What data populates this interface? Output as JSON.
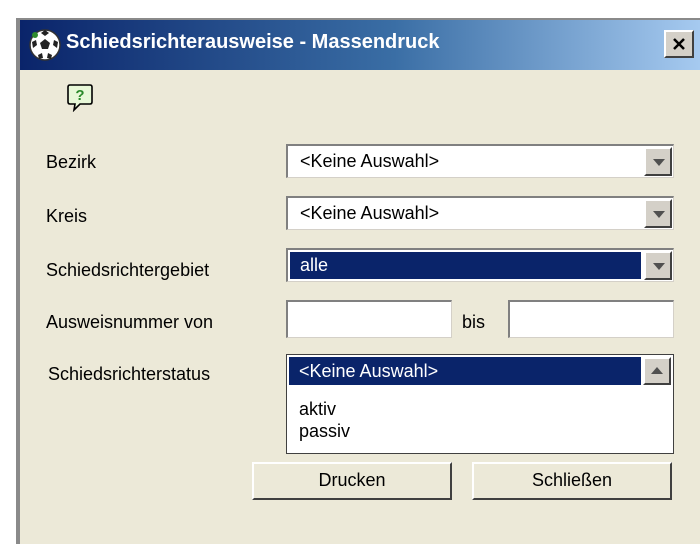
{
  "window": {
    "title": "Schiedsrichterausweise - Massendruck",
    "close_glyph": "×"
  },
  "toolbar": {
    "help_icon": "help-question-icon"
  },
  "form": {
    "bezirk": {
      "label": "Bezirk",
      "value": "<Keine Auswahl>"
    },
    "kreis": {
      "label": "Kreis",
      "value": "<Keine Auswahl>"
    },
    "gebiet": {
      "label": "Schiedsrichtergebiet",
      "value": "alle"
    },
    "ausweis": {
      "label_from": "Ausweisnummer von",
      "label_to": "bis",
      "value_from": "",
      "value_to": ""
    },
    "status": {
      "label": "Schiedsrichterstatus",
      "options": [
        "<Keine Auswahl>",
        "aktiv",
        "passiv"
      ],
      "selected": "<Keine Auswahl>"
    }
  },
  "buttons": {
    "print": "Drucken",
    "close": "Schließen"
  },
  "colors": {
    "selection": "#0a246a",
    "dialog_bg": "#ece9d8",
    "title_start": "#0a246a",
    "title_end": "#a6caf0"
  }
}
